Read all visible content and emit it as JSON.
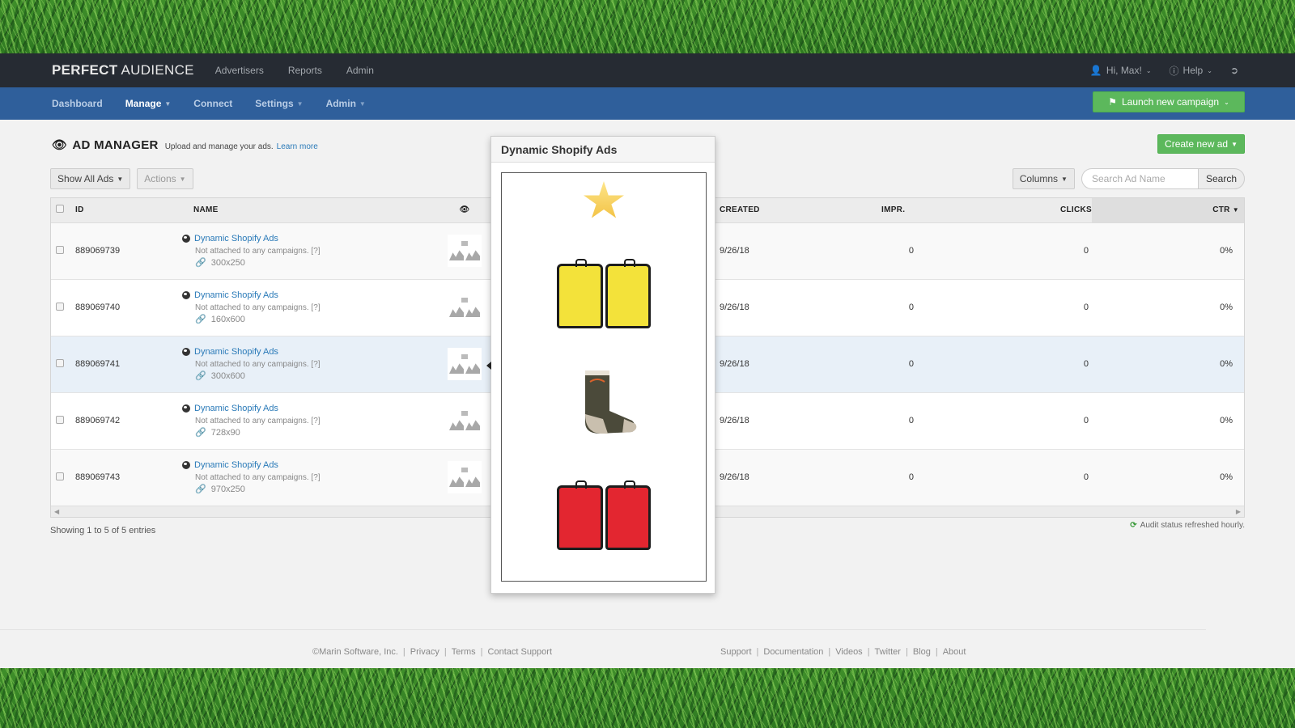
{
  "brand": {
    "bold": "PERFECT",
    "light": " AUDIENCE"
  },
  "topnav": [
    "Advertisers",
    "Reports",
    "Admin"
  ],
  "user_menu": {
    "greeting": "Hi, Max!",
    "help": "Help"
  },
  "subnav": {
    "items": [
      {
        "label": "Dashboard",
        "active": false,
        "dropdown": false
      },
      {
        "label": "Manage",
        "active": true,
        "dropdown": true
      },
      {
        "label": "Connect",
        "active": false,
        "dropdown": false
      },
      {
        "label": "Settings",
        "active": false,
        "dropdown": true
      },
      {
        "label": "Admin",
        "active": false,
        "dropdown": true
      }
    ],
    "launch_button": "Launch new campaign"
  },
  "page": {
    "title": "AD MANAGER",
    "subtitle": "Upload and manage your ads.",
    "learn_more": "Learn more",
    "create_button": "Create new ad"
  },
  "toolbar": {
    "filter": "Show All Ads",
    "actions": "Actions",
    "columns": "Columns",
    "search_placeholder": "Search Ad Name",
    "search_button": "Search"
  },
  "table": {
    "headers": {
      "id": "ID",
      "name": "NAME",
      "created": "CREATED",
      "impr": "IMPR.",
      "clicks": "CLICKS",
      "ctr": "CTR"
    },
    "rows": [
      {
        "id": "889069739",
        "name": "Dynamic Shopify Ads",
        "status": "Not attached to any campaigns. [?]",
        "size": "300x250",
        "created": "9/26/18",
        "impr": "0",
        "clicks": "0",
        "ctr": "0%"
      },
      {
        "id": "889069740",
        "name": "Dynamic Shopify Ads",
        "status": "Not attached to any campaigns. [?]",
        "size": "160x600",
        "created": "9/26/18",
        "impr": "0",
        "clicks": "0",
        "ctr": "0%"
      },
      {
        "id": "889069741",
        "name": "Dynamic Shopify Ads",
        "status": "Not attached to any campaigns. [?]",
        "size": "300x600",
        "created": "9/26/18",
        "impr": "0",
        "clicks": "0",
        "ctr": "0%"
      },
      {
        "id": "889069742",
        "name": "Dynamic Shopify Ads",
        "status": "Not attached to any campaigns. [?]",
        "size": "728x90",
        "created": "9/26/18",
        "impr": "0",
        "clicks": "0",
        "ctr": "0%"
      },
      {
        "id": "889069743",
        "name": "Dynamic Shopify Ads",
        "status": "Not attached to any campaigns. [?]",
        "size": "970x250",
        "created": "9/26/18",
        "impr": "0",
        "clicks": "0",
        "ctr": "0%"
      }
    ]
  },
  "showing": "Showing 1 to 5 of 5 entries",
  "audit": "Audit status refreshed hourly.",
  "popover": {
    "title": "Dynamic Shopify Ads",
    "products": [
      "star",
      "yellow-panniers",
      "wool-sock",
      "red-panniers"
    ]
  },
  "footer": {
    "left": [
      "©Marin Software, Inc.",
      "Privacy",
      "Terms",
      "Contact Support"
    ],
    "right": [
      "Support",
      "Documentation",
      "Videos",
      "Twitter",
      "Blog",
      "About"
    ]
  },
  "colors": {
    "topbar": "#262b33",
    "subnav": "#2f5f9b",
    "accent_green": "#5cb85c",
    "link_blue": "#2a7ab8"
  }
}
